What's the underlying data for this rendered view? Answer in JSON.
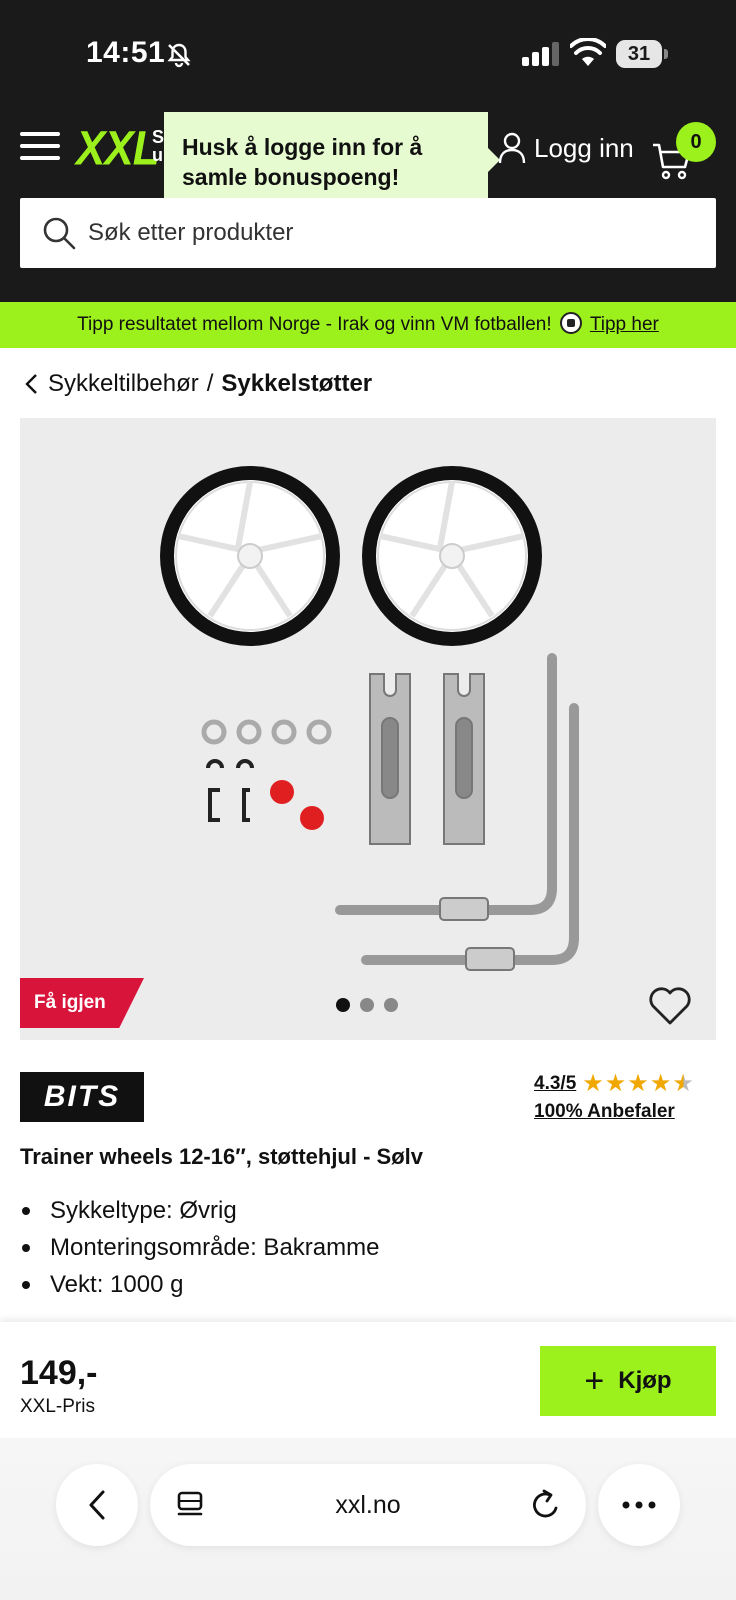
{
  "status_bar": {
    "time": "14:51",
    "battery": "31"
  },
  "header": {
    "logo": "XXL",
    "logo_sub": "S\nu",
    "tooltip": "Husk å logge inn for å samle bonuspoeng!",
    "login_label": "Logg inn",
    "cart_count": "0",
    "search_placeholder": "Søk etter produkter"
  },
  "promo": {
    "text": "Tipp resultatet mellom Norge - Irak og vinn VM fotballen!",
    "link": "Tipp her"
  },
  "breadcrumb": {
    "parent": "Sykkeltilbehør",
    "separator": "/",
    "current": "Sykkelstøtter"
  },
  "product": {
    "badge": "Få igjen",
    "brand": "BITS",
    "rating_score": "4.3/5",
    "rating_value": 4.3,
    "recommend": "100% Anbefaler",
    "title": "Trainer wheels 12-16″, støttehjul - Sølv",
    "specs": [
      "Sykkeltype: Øvrig",
      "Monteringsområde: Bakramme",
      "Vekt: 1000 g"
    ],
    "image_count": 3,
    "active_image": 1
  },
  "buy_bar": {
    "price": "149,-",
    "price_label": "XXL-Pris",
    "buy_label": "Kjøp"
  },
  "browser": {
    "url": "xxl.no"
  },
  "colors": {
    "brand_green": "#9cf01c",
    "badge_red": "#d9143a",
    "header_bg": "#1a1a1a",
    "star": "#f0a800"
  }
}
